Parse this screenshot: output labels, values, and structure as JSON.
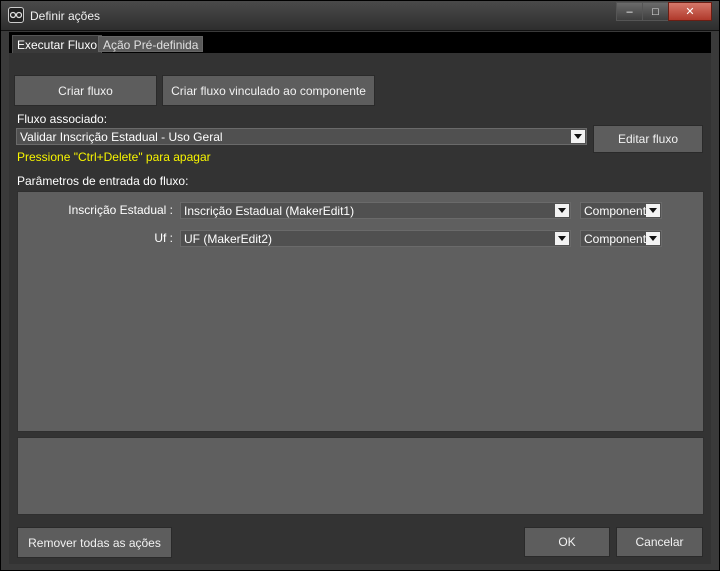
{
  "window": {
    "title": "Definir ações",
    "controls": {
      "minimize": "–",
      "maximize": "□",
      "close": "✕"
    }
  },
  "tabs": [
    {
      "label": "Executar Fluxo",
      "active": true
    },
    {
      "label": "Ação Pré-definida",
      "active": false
    }
  ],
  "actions": {
    "create_flow": "Criar fluxo",
    "create_linked_flow": "Criar fluxo vinculado ao componente"
  },
  "flow": {
    "label": "Fluxo associado:",
    "selected": "Validar Inscrição Estadual - Uso Geral",
    "edit_button": "Editar fluxo",
    "hint": "Pressione \"Ctrl+Delete\" para apagar"
  },
  "params": {
    "label": "Parâmetros de entrada do fluxo:",
    "rows": [
      {
        "name": "Inscrição Estadual :",
        "value": "Inscrição Estadual (MakerEdit1)",
        "type": "Componente"
      },
      {
        "name": "Uf :",
        "value": "UF (MakerEdit2)",
        "type": "Componente"
      }
    ]
  },
  "footer": {
    "remove_all": "Remover todas as ações",
    "ok": "OK",
    "cancel": "Cancelar"
  },
  "colors": {
    "hint": "#f7f500",
    "button": "#5d5d5d",
    "background": "#3a3a3a",
    "close": "#c2483a"
  }
}
